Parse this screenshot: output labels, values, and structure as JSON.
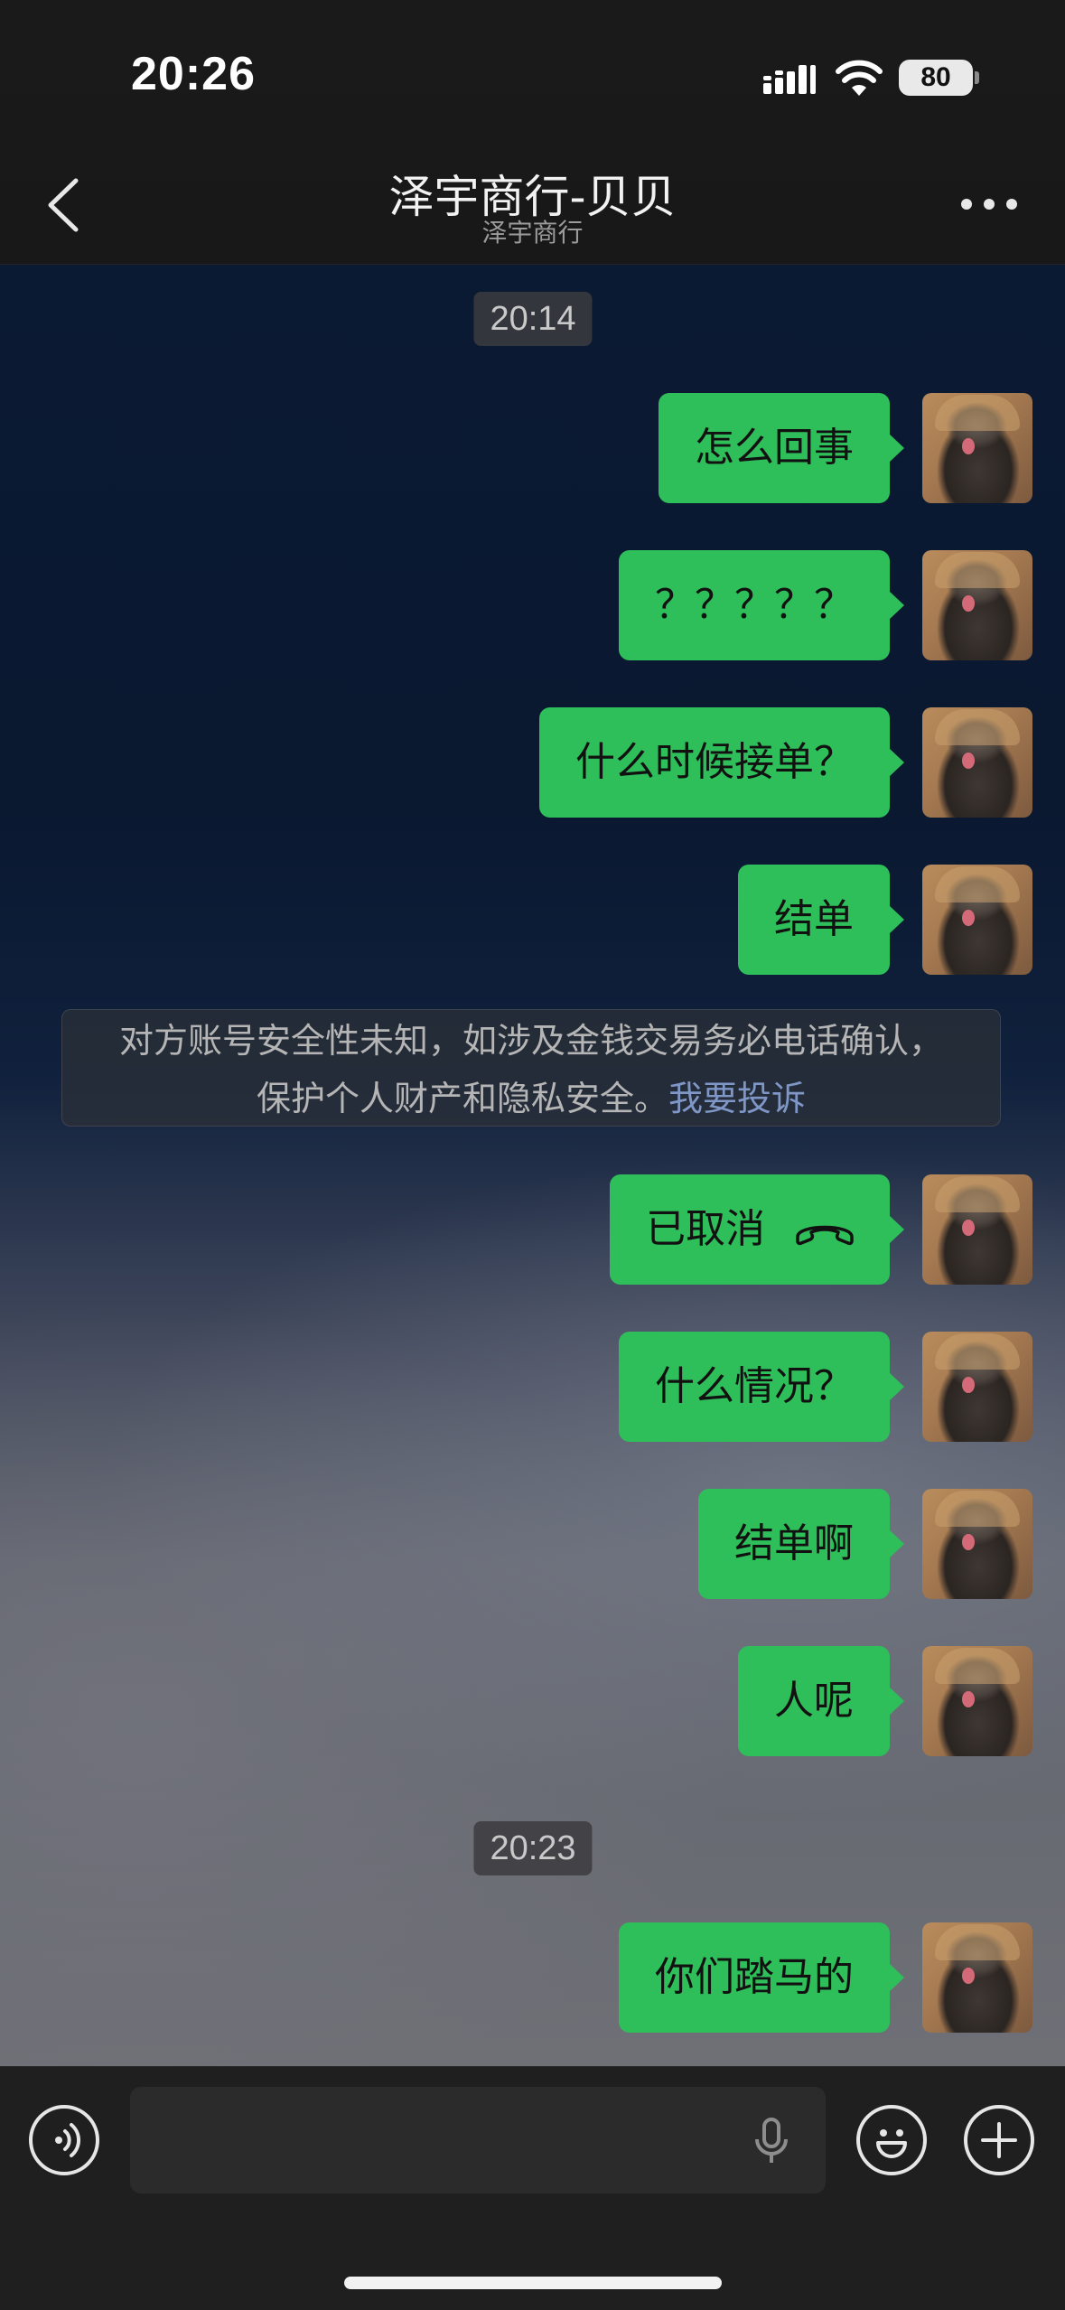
{
  "status_bar": {
    "time": "20:26",
    "battery": "80"
  },
  "header": {
    "title": "泽宇商行-贝贝",
    "subtitle": "泽宇商行"
  },
  "chat": {
    "timestamps": [
      "20:14",
      "20:23"
    ],
    "messages": [
      "怎么回事",
      "？？？？？",
      "什么时候接单？",
      "结单",
      "已取消",
      "什么情况？",
      "结单啊",
      "人呢",
      "你们踏马的"
    ],
    "notice": {
      "line1": "对方账号安全性未知，如涉及金钱交易务必电话确认，",
      "line2": "保护个人财产和隐私安全。",
      "link": "我要投诉"
    }
  },
  "icons": {
    "back": "chevron-left-icon",
    "more": "more-dots-icon",
    "call": "phone-hangup-icon",
    "voice": "voice-icon",
    "mic": "microphone-icon",
    "emoji": "emoji-icon",
    "plus": "plus-icon"
  },
  "colors": {
    "bubble": "#2fbf5a",
    "link": "#7f97c7"
  }
}
